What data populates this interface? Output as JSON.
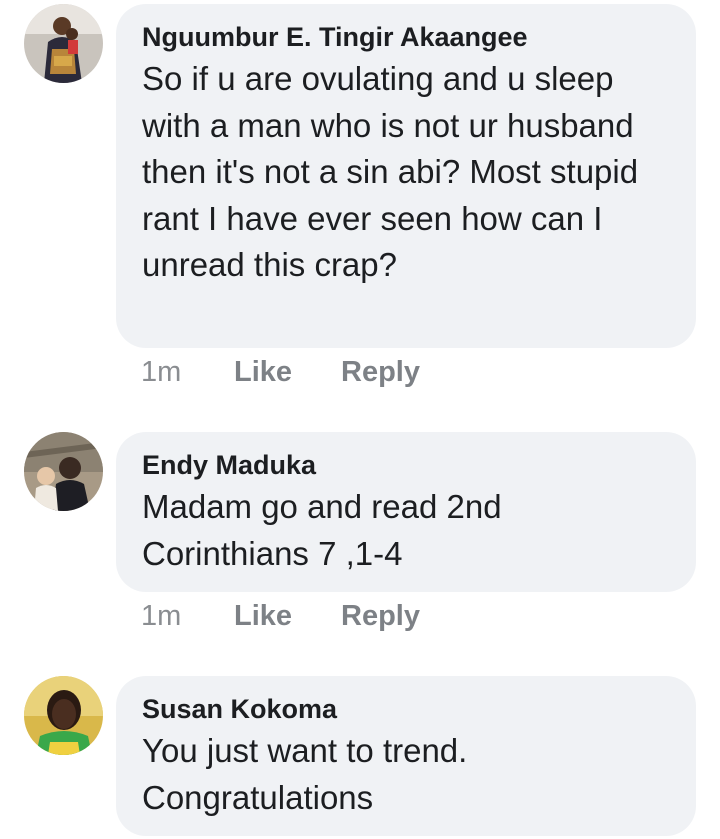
{
  "comments": [
    {
      "author": "Nguumbur E. Tingir Akaangee",
      "text": "So if u are ovulating and u sleep with a man who is not ur husband then it's not a sin abi? Most stupid rant I have ever seen how can I unread this crap?",
      "time": "1m",
      "like_label": "Like",
      "reply_label": "Reply"
    },
    {
      "author": "Endy Maduka",
      "text": "Madam go and read 2nd Corinthians 7 ,1-4",
      "time": "1m",
      "like_label": "Like",
      "reply_label": "Reply"
    },
    {
      "author": "Susan Kokoma",
      "text": "You just want to trend. Congratulations"
    }
  ],
  "colors": {
    "bubble": "#f0f2f5",
    "text": "#1c1e21",
    "meta": "#8a8d91"
  }
}
